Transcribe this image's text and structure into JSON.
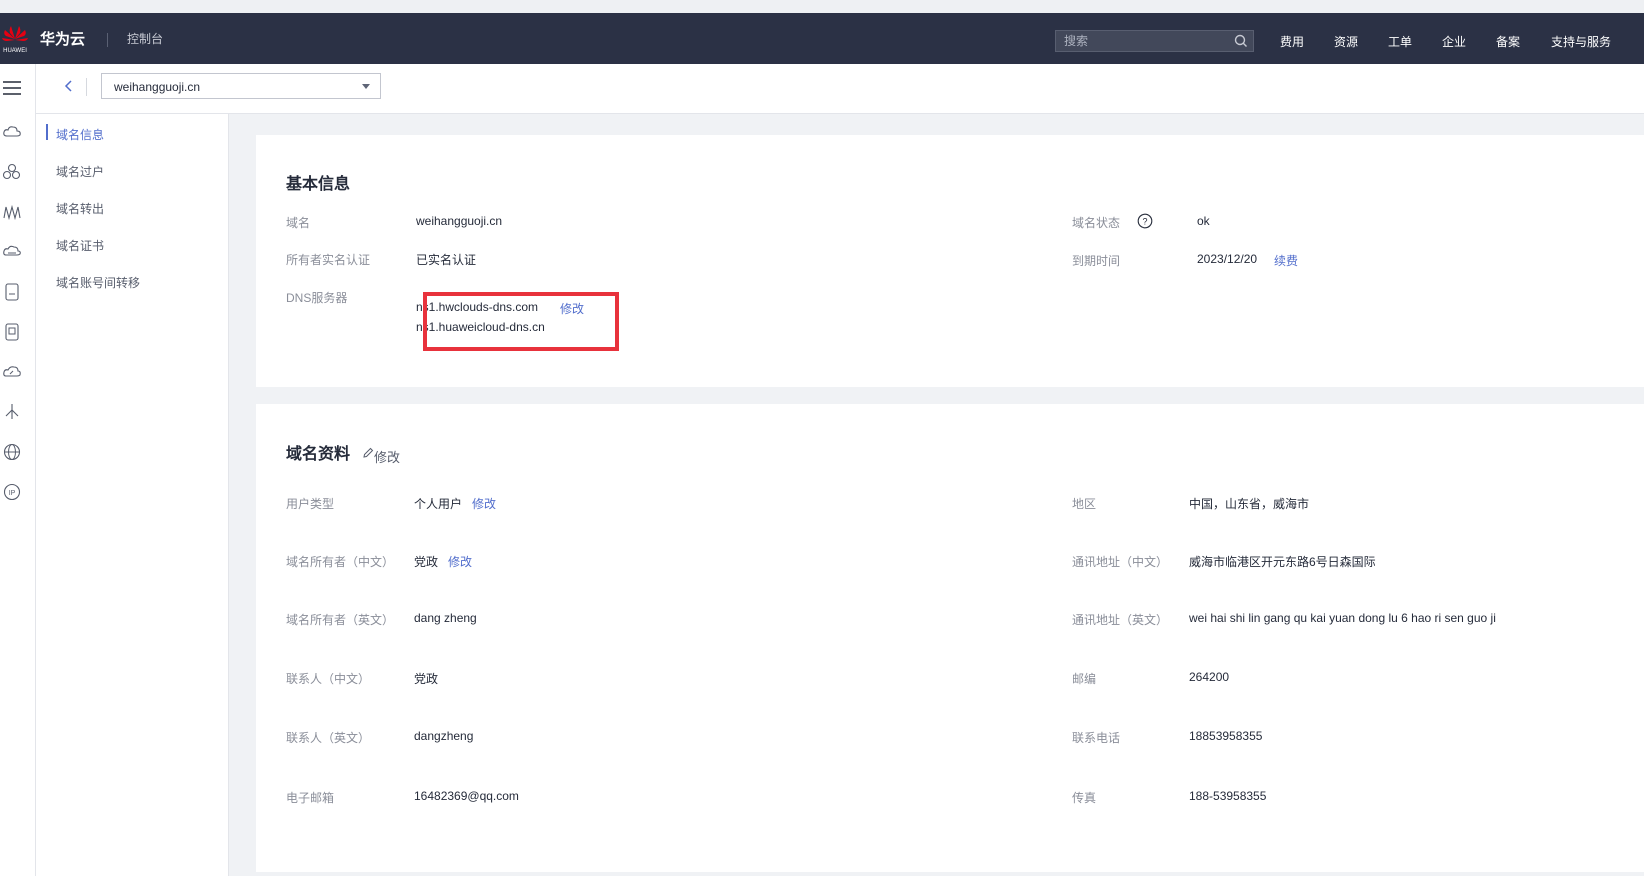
{
  "header": {
    "brand": "华为云",
    "logo_text": "HUAWEI",
    "console": "控制台",
    "search_placeholder": "搜索",
    "nav": [
      "费用",
      "资源",
      "工单",
      "企业",
      "备案",
      "支持与服务"
    ]
  },
  "breadcrumb": {
    "domain_selected": "weihangguoji.cn"
  },
  "subnav": {
    "items": [
      "域名信息",
      "域名过户",
      "域名转出",
      "域名证书",
      "域名账号间转移"
    ],
    "active_index": 0
  },
  "basic_info": {
    "title": "基本信息",
    "domain_label": "域名",
    "domain_value": "weihangguoji.cn",
    "owner_auth_label": "所有者实名认证",
    "owner_auth_value": "已实名认证",
    "dns_label": "DNS服务器",
    "dns_servers": [
      "ns1.hwclouds-dns.com",
      "ns1.huaweicloud-dns.cn"
    ],
    "dns_edit": "修改",
    "status_label": "域名状态",
    "status_value": "ok",
    "expire_label": "到期时间",
    "expire_value": "2023/12/20",
    "renew_link": "续费"
  },
  "profile": {
    "title": "域名资料",
    "edit_link": "修改",
    "user_type_label": "用户类型",
    "user_type_value": "个人用户",
    "user_type_edit": "修改",
    "owner_cn_label": "域名所有者（中文）",
    "owner_cn_value": "党政",
    "owner_cn_edit": "修改",
    "owner_en_label": "域名所有者（英文）",
    "owner_en_value": "dang zheng",
    "contact_cn_label": "联系人（中文）",
    "contact_cn_value": "党政",
    "contact_en_label": "联系人（英文）",
    "contact_en_value": "dangzheng",
    "email_label": "电子邮箱",
    "email_value": "16482369@qq.com",
    "region_label": "地区",
    "region_value": "中国，山东省，威海市",
    "addr_cn_label": "通讯地址（中文）",
    "addr_cn_value": "威海市临港区开元东路6号日森国际",
    "addr_en_label": "通讯地址（英文）",
    "addr_en_value": "wei hai shi lin gang qu kai yuan dong lu 6 hao ri sen guo ji",
    "zip_label": "邮编",
    "zip_value": "264200",
    "phone_label": "联系电话",
    "phone_value": "18853958355",
    "fax_label": "传真",
    "fax_value": "188-53958355"
  },
  "colors": {
    "topbar": "#2b3145",
    "accent": "#526ecc",
    "highlight": "#e8323c"
  }
}
